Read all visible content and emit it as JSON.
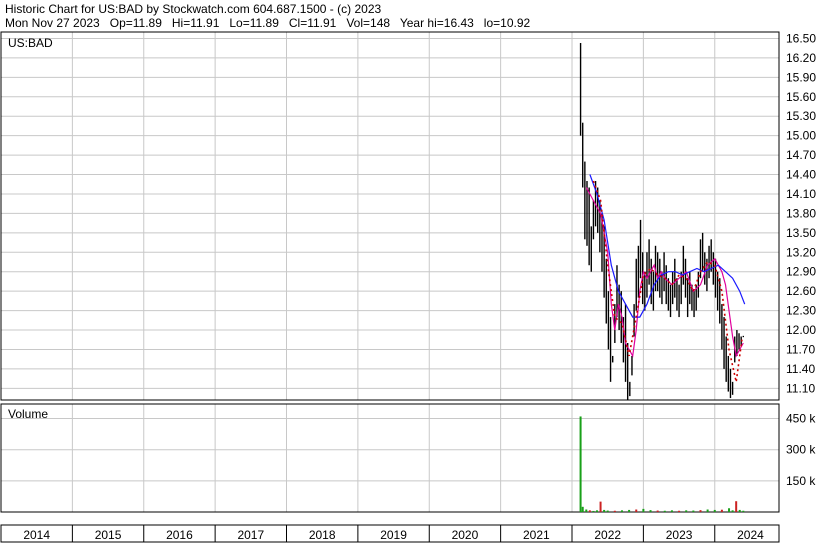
{
  "header": {
    "line1": "Historic Chart for US:BAD by Stockwatch.com 604.687.1500 - (c) 2023",
    "line2": "Mon Nov 27 2023   Op=11.89   Hi=11.91   Lo=11.89   Cl=11.91   Vol=148   Year hi=16.43   lo=10.92"
  },
  "chart_data": [
    {
      "type": "line",
      "panel_label": "US:BAD",
      "ylim": [
        10.92,
        16.6
      ],
      "y_ticks": [
        "16.50",
        "16.20",
        "15.90",
        "15.60",
        "15.30",
        "15.00",
        "14.70",
        "14.40",
        "14.10",
        "13.80",
        "13.50",
        "13.20",
        "12.90",
        "12.60",
        "12.30",
        "12.00",
        "11.70",
        "11.40",
        "11.10"
      ],
      "x_ticks": [
        "2014",
        "2015",
        "2016",
        "2017",
        "2018",
        "2019",
        "2020",
        "2021",
        "2022",
        "2023",
        "2024"
      ],
      "grid": true,
      "series": [
        {
          "style": "price-bars",
          "color": "#000000",
          "x": [
            2021.62,
            2021.65,
            2021.68,
            2021.71,
            2021.74,
            2021.77,
            2021.8,
            2021.83,
            2021.86,
            2021.89,
            2021.92,
            2021.95,
            2021.98,
            2022.01,
            2022.04,
            2022.07,
            2022.1,
            2022.13,
            2022.16,
            2022.19,
            2022.22,
            2022.25,
            2022.28,
            2022.31,
            2022.34,
            2022.37,
            2022.4,
            2022.43,
            2022.46,
            2022.49,
            2022.52,
            2022.55,
            2022.58,
            2022.61,
            2022.64,
            2022.67,
            2022.7,
            2022.73,
            2022.76,
            2022.79,
            2022.82,
            2022.85,
            2022.88,
            2022.91,
            2022.94,
            2022.97,
            2023.0,
            2023.03,
            2023.06,
            2023.09,
            2023.12,
            2023.15,
            2023.18,
            2023.21,
            2023.24,
            2023.27,
            2023.3,
            2023.33,
            2023.36,
            2023.39,
            2023.42,
            2023.45,
            2023.48,
            2023.51,
            2023.54,
            2023.57,
            2023.6,
            2023.63,
            2023.66,
            2023.69,
            2023.72,
            2023.75,
            2023.78,
            2023.81,
            2023.84,
            2023.87,
            2023.9
          ],
          "high": [
            16.43,
            15.2,
            14.6,
            14.3,
            14.2,
            13.6,
            14.0,
            14.3,
            14.2,
            14.0,
            13.8,
            13.6,
            13.1,
            12.6,
            12.2,
            11.6,
            12.4,
            13.0,
            12.7,
            12.6,
            12.2,
            12.4,
            11.8,
            11.2,
            11.6,
            12.4,
            13.1,
            13.3,
            13.7,
            13.2,
            12.9,
            13.2,
            13.4,
            13.1,
            12.9,
            13.3,
            13.2,
            13.1,
            12.9,
            13.2,
            13.0,
            12.8,
            12.7,
            12.9,
            13.1,
            12.8,
            12.7,
            12.9,
            13.3,
            13.1,
            12.8,
            12.9,
            12.7,
            12.6,
            12.7,
            12.9,
            13.4,
            13.5,
            13.2,
            13.1,
            13.3,
            13.4,
            13.2,
            13.1,
            12.9,
            12.8,
            12.4,
            12.2,
            11.9,
            11.6,
            11.4,
            11.2,
            11.9,
            12.0,
            11.95,
            11.9,
            11.91
          ],
          "low": [
            15.0,
            14.2,
            13.4,
            13.3,
            13.0,
            12.9,
            13.4,
            13.6,
            13.5,
            13.2,
            12.9,
            12.5,
            12.1,
            11.7,
            11.2,
            11.5,
            11.8,
            12.2,
            12.0,
            11.8,
            11.5,
            11.2,
            10.92,
            10.98,
            11.3,
            11.9,
            12.3,
            12.5,
            12.8,
            12.4,
            12.3,
            12.5,
            12.7,
            12.4,
            12.3,
            12.6,
            12.6,
            12.5,
            12.4,
            12.6,
            12.4,
            12.3,
            12.2,
            12.4,
            12.5,
            12.3,
            12.2,
            12.4,
            12.7,
            12.5,
            12.2,
            12.4,
            12.3,
            12.2,
            12.3,
            12.5,
            12.8,
            12.9,
            12.7,
            12.6,
            12.8,
            12.9,
            12.7,
            12.5,
            12.3,
            12.1,
            11.7,
            11.4,
            11.2,
            11.05,
            10.95,
            11.0,
            11.5,
            11.6,
            11.7,
            11.75,
            11.89
          ]
        },
        {
          "style": "line",
          "color": "#e0009c",
          "x": [
            2021.7,
            2021.8,
            2021.9,
            2022.0,
            2022.05,
            2022.1,
            2022.15,
            2022.2,
            2022.25,
            2022.3,
            2022.35,
            2022.4,
            2022.45,
            2022.5,
            2022.55,
            2022.6,
            2022.65,
            2022.7,
            2022.75,
            2022.8,
            2022.9,
            2023.0,
            2023.1,
            2023.2,
            2023.3,
            2023.4,
            2023.5,
            2023.6,
            2023.65,
            2023.7,
            2023.75,
            2023.8,
            2023.85,
            2023.9
          ],
          "y": [
            14.2,
            14.0,
            13.8,
            13.2,
            12.4,
            12.0,
            12.4,
            12.2,
            11.8,
            11.7,
            11.6,
            12.0,
            12.6,
            12.9,
            12.8,
            12.9,
            13.0,
            12.8,
            12.9,
            12.8,
            12.7,
            12.8,
            12.9,
            12.6,
            12.7,
            13.0,
            13.1,
            12.9,
            12.7,
            12.3,
            11.9,
            11.6,
            11.7,
            11.8
          ]
        },
        {
          "style": "line",
          "color": "#1a1aff",
          "x": [
            2021.75,
            2021.85,
            2021.95,
            2022.05,
            2022.15,
            2022.25,
            2022.35,
            2022.45,
            2022.55,
            2022.65,
            2022.75,
            2022.85,
            2022.95,
            2023.05,
            2023.15,
            2023.25,
            2023.35,
            2023.45,
            2023.55,
            2023.65,
            2023.75,
            2023.85,
            2023.92
          ],
          "y": [
            14.4,
            14.1,
            13.7,
            13.0,
            12.6,
            12.4,
            12.2,
            12.2,
            12.4,
            12.7,
            12.85,
            12.9,
            12.9,
            12.85,
            12.9,
            12.95,
            12.9,
            12.95,
            13.0,
            12.9,
            12.8,
            12.6,
            12.4
          ]
        },
        {
          "style": "dotted",
          "color": "#cc0000",
          "x": [
            2021.8,
            2021.9,
            2022.0,
            2022.1,
            2022.2,
            2022.3,
            2022.4,
            2022.5,
            2022.6,
            2022.7,
            2022.8,
            2022.9,
            2023.0,
            2023.1,
            2023.2,
            2023.3,
            2023.4,
            2023.5,
            2023.6,
            2023.7,
            2023.8,
            2023.88
          ],
          "y": [
            14.3,
            14.0,
            13.0,
            12.2,
            12.1,
            11.6,
            12.2,
            12.85,
            12.95,
            12.85,
            12.8,
            12.7,
            12.85,
            12.8,
            12.6,
            12.9,
            13.05,
            13.0,
            12.6,
            11.7,
            11.2,
            11.85
          ]
        }
      ]
    },
    {
      "type": "bar",
      "panel_label": "Volume",
      "ylim": [
        0,
        520
      ],
      "y_ticks": [
        "450 k",
        "300 k",
        "150 k"
      ],
      "x": [
        2021.62,
        2021.65,
        2021.7,
        2021.75,
        2021.8,
        2021.85,
        2021.9,
        2021.95,
        2022.0,
        2022.1,
        2022.2,
        2022.3,
        2022.4,
        2022.5,
        2022.6,
        2022.7,
        2022.8,
        2022.9,
        2023.0,
        2023.1,
        2023.2,
        2023.3,
        2023.4,
        2023.5,
        2023.6,
        2023.7,
        2023.75,
        2023.8,
        2023.85,
        2023.9
      ],
      "values": [
        460,
        25,
        12,
        8,
        5,
        8,
        50,
        10,
        7,
        6,
        8,
        10,
        12,
        15,
        9,
        7,
        6,
        8,
        6,
        8,
        7,
        9,
        12,
        10,
        11,
        18,
        8,
        52,
        10,
        6
      ]
    }
  ]
}
